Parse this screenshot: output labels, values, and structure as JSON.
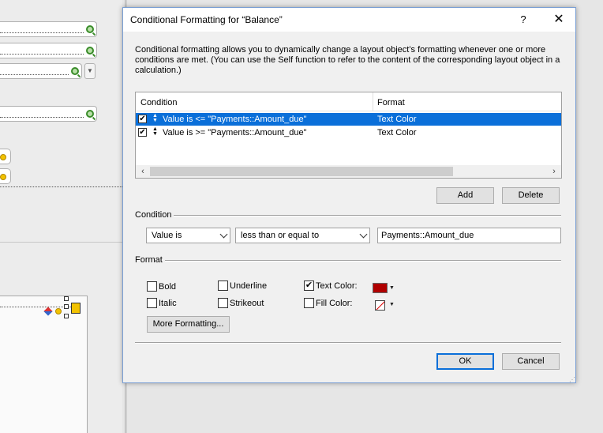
{
  "dialog": {
    "title": "Conditional Formatting for “Balance”",
    "help_label": "?",
    "close_label": "✕",
    "description": "Conditional formatting allows you to dynamically change a layout object’s formatting whenever one or more conditions are met.  (You can use the Self function to refer to the content of the corresponding layout object in a calculation.)"
  },
  "table": {
    "headers": {
      "condition": "Condition",
      "format": "Format"
    },
    "rows": [
      {
        "checked": true,
        "condition": "Value is <= \"Payments::Amount_due\"",
        "format": "Text Color",
        "selected": true
      },
      {
        "checked": true,
        "condition": "Value is >= \"Payments::Amount_due\"",
        "format": "Text Color",
        "selected": false
      }
    ]
  },
  "buttons": {
    "add": "Add",
    "delete": "Delete",
    "more_formatting": "More Formatting...",
    "ok": "OK",
    "cancel": "Cancel"
  },
  "condition": {
    "section_label": "Condition",
    "type_value": "Value is",
    "operator_value": "less than or equal to",
    "value_text": "Payments::Amount_due"
  },
  "format": {
    "section_label": "Format",
    "bold": {
      "label": "Bold",
      "checked": false
    },
    "italic": {
      "label": "Italic",
      "checked": false
    },
    "underline": {
      "label": "Underline",
      "checked": false
    },
    "strikeout": {
      "label": "Strikeout",
      "checked": false
    },
    "text_color": {
      "label": "Text Color:",
      "checked": true,
      "color": "#b00000"
    },
    "fill_color": {
      "label": "Fill Color:",
      "checked": false,
      "color": "none"
    }
  }
}
